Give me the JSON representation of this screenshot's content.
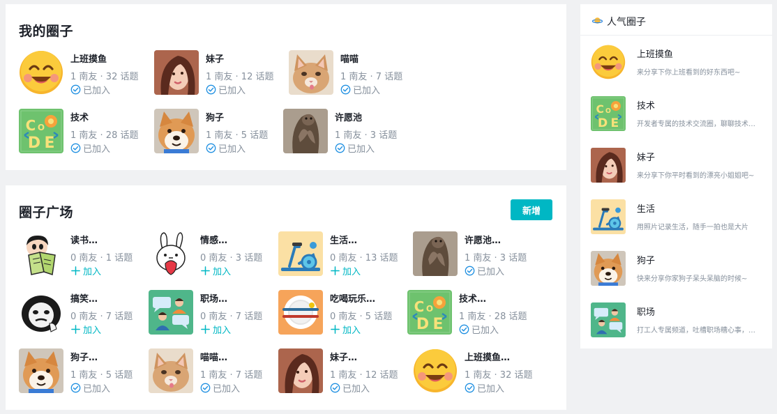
{
  "my_circles": {
    "title": "我的圈子",
    "items": [
      {
        "name": "上班摸鱼",
        "stats": "1 南友 · 32 话题",
        "action": "已加入",
        "avatar": "smiley-face-icon"
      },
      {
        "name": "妹子",
        "stats": "1 南友 · 12 话题",
        "action": "已加入",
        "avatar": "girl-photo"
      },
      {
        "name": "喵喵",
        "stats": "1 南友 · 7 话题",
        "action": "已加入",
        "avatar": "kitten-photo"
      },
      {
        "name": "技术",
        "stats": "1 南友 · 28 话题",
        "action": "已加入",
        "avatar": "code-logo"
      },
      {
        "name": "狗子",
        "stats": "1 南友 · 5 话题",
        "action": "已加入",
        "avatar": "shiba-photo"
      },
      {
        "name": "许愿池",
        "stats": "1 南友 · 3 话题",
        "action": "已加入",
        "avatar": "otter-photo"
      }
    ]
  },
  "plaza": {
    "title": "圈子广场",
    "new_button": "新增",
    "items": [
      {
        "name": "读书…",
        "stats": "0 南友 · 1 话题",
        "action": "加入",
        "joined": false,
        "avatar": "reading-cartoon"
      },
      {
        "name": "情感…",
        "stats": "0 南友 · 3 话题",
        "action": "加入",
        "joined": false,
        "avatar": "bunny-heart-cartoon"
      },
      {
        "name": "生活…",
        "stats": "0 南友 · 13 话题",
        "action": "加入",
        "joined": false,
        "avatar": "exercise-bike"
      },
      {
        "name": "许愿池…",
        "stats": "1 南友 · 3 话题",
        "action": "已加入",
        "joined": true,
        "avatar": "otter-photo"
      },
      {
        "name": "搞笑…",
        "stats": "0 南友 · 7 话题",
        "action": "加入",
        "joined": false,
        "avatar": "panda-meme"
      },
      {
        "name": "职场…",
        "stats": "0 南友 · 7 话题",
        "action": "加入",
        "joined": false,
        "avatar": "workplace-chat"
      },
      {
        "name": "吃喝玩乐…",
        "stats": "0 南友 · 5 话题",
        "action": "加入",
        "joined": false,
        "avatar": "dinner-plate"
      },
      {
        "name": "技术…",
        "stats": "1 南友 · 28 话题",
        "action": "已加入",
        "joined": true,
        "avatar": "code-logo"
      },
      {
        "name": "狗子…",
        "stats": "1 南友 · 5 话题",
        "action": "已加入",
        "joined": true,
        "avatar": "shiba-photo"
      },
      {
        "name": "喵喵…",
        "stats": "1 南友 · 7 话题",
        "action": "已加入",
        "joined": true,
        "avatar": "kitten-photo"
      },
      {
        "name": "妹子…",
        "stats": "1 南友 · 12 话题",
        "action": "已加入",
        "joined": true,
        "avatar": "girl-photo"
      },
      {
        "name": "上班摸鱼…",
        "stats": "1 南友 · 32 话题",
        "action": "已加入",
        "joined": true,
        "avatar": "smiley-face-icon"
      }
    ]
  },
  "hot": {
    "title": "人气圈子",
    "header_icon": "planet-icon",
    "items": [
      {
        "name": "上班摸鱼",
        "desc": "来分享下你上班看到的好东西吧~",
        "avatar": "smiley-face-icon"
      },
      {
        "name": "技术",
        "desc": "开发者专属的技术交流圈，聊聊技术…",
        "avatar": "code-logo"
      },
      {
        "name": "妹子",
        "desc": "来分享下你平时看到的漂亮小姐姐吧~",
        "avatar": "girl-photo"
      },
      {
        "name": "生活",
        "desc": "用照片记录生活，随手一拍也是大片",
        "avatar": "exercise-bike"
      },
      {
        "name": "狗子",
        "desc": "快来分享你家狗子呆头呆脑的时候~",
        "avatar": "shiba-photo"
      },
      {
        "name": "职场",
        "desc": "打工人专属频道，吐槽职场糟心事，…",
        "avatar": "workplace-chat"
      }
    ]
  },
  "colors": {
    "accent": "#00b7c4",
    "text": "#1d2129",
    "muted": "#86909c"
  }
}
